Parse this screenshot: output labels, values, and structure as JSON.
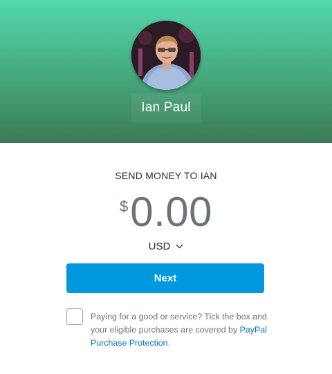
{
  "header": {
    "recipient_name": "Ian Paul",
    "gradient_top": "#54d8ae",
    "gradient_bottom": "#3a7a55"
  },
  "send": {
    "title": "SEND MONEY TO IAN",
    "currency_symbol": "$",
    "amount": "0.00",
    "currency_code": "USD"
  },
  "actions": {
    "next_label": "Next",
    "button_color": "#0099e0"
  },
  "protection": {
    "text": "Paying for a good or service? Tick the box and your eligible purchases are covered by",
    "link_text": "PayPal Purchase Protection",
    "suffix": ".",
    "checked": false,
    "link_color": "#0070ba"
  },
  "icons": {
    "currency_dropdown": "chevron-down-icon",
    "avatar": "user-photo"
  }
}
